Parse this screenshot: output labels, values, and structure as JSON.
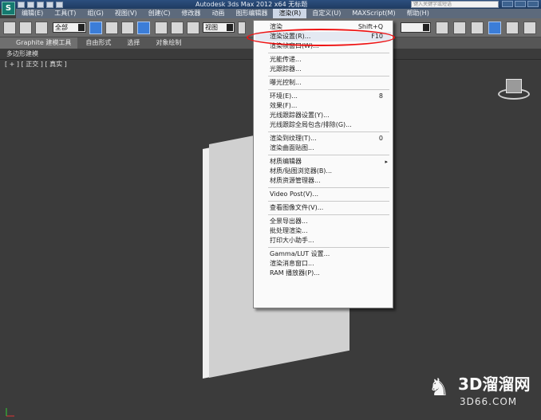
{
  "title_bar": {
    "title": "Autodesk 3ds Max  2012 x64      无标题",
    "search_placeholder": "键入关键字或短语"
  },
  "menubar": {
    "items": [
      {
        "label": "编辑(E)"
      },
      {
        "label": "工具(T)"
      },
      {
        "label": "组(G)"
      },
      {
        "label": "视图(V)"
      },
      {
        "label": "创建(C)"
      },
      {
        "label": "修改器"
      },
      {
        "label": "动画"
      },
      {
        "label": "图形编辑器"
      },
      {
        "label": "渲染(R)",
        "active": true
      },
      {
        "label": "自定义(U)"
      },
      {
        "label": "MAXScript(M)"
      },
      {
        "label": "帮助(H)"
      }
    ]
  },
  "toolbar": {
    "selection_filter": "全部",
    "reference_coord": "视图"
  },
  "ribbon": {
    "tabs": [
      "Graphite 建模工具",
      "自由形式",
      "选择",
      "对象绘制"
    ],
    "sub_label": "多边形建模"
  },
  "viewport": {
    "label": "[ + ] [ 正交 ] [ 真实 ]"
  },
  "render_menu": {
    "items": [
      {
        "label": "渲染",
        "shortcut": "Shift+Q"
      },
      {
        "label": "渲染设置(R)...",
        "shortcut": "F10",
        "highlighted": true
      },
      {
        "label": "渲染帧窗口(W)...",
        "shortcut": ""
      },
      {
        "separator": true
      },
      {
        "label": "光能传递...",
        "shortcut": ""
      },
      {
        "label": "光跟踪器...",
        "shortcut": ""
      },
      {
        "separator": true
      },
      {
        "label": "曝光控制...",
        "shortcut": ""
      },
      {
        "separator": true
      },
      {
        "label": "环境(E)...",
        "shortcut": "8"
      },
      {
        "label": "效果(F)...",
        "shortcut": ""
      },
      {
        "label": "光线跟踪器设置(Y)...",
        "shortcut": ""
      },
      {
        "label": "光线跟踪全局包含/排除(G)...",
        "shortcut": ""
      },
      {
        "separator": true
      },
      {
        "label": "渲染到纹理(T)...",
        "shortcut": "0"
      },
      {
        "label": "渲染曲面贴图...",
        "shortcut": ""
      },
      {
        "separator": true
      },
      {
        "label": "材质编辑器",
        "shortcut": "",
        "submenu": true
      },
      {
        "label": "材质/贴图浏览器(B)...",
        "shortcut": ""
      },
      {
        "label": "材质资源管理器...",
        "shortcut": ""
      },
      {
        "separator": true
      },
      {
        "label": "Video Post(V)...",
        "shortcut": ""
      },
      {
        "separator": true
      },
      {
        "label": "查看图像文件(V)...",
        "shortcut": ""
      },
      {
        "separator": true
      },
      {
        "label": "全景导出器...",
        "shortcut": ""
      },
      {
        "label": "批处理渲染...",
        "shortcut": ""
      },
      {
        "label": "打印大小助手...",
        "shortcut": ""
      },
      {
        "separator": true
      },
      {
        "label": "Gamma/LUT 设置...",
        "shortcut": ""
      },
      {
        "label": "渲染消息窗口...",
        "shortcut": ""
      },
      {
        "label": "RAM 播放器(P)...",
        "shortcut": ""
      }
    ]
  },
  "watermark": {
    "brand": "3D溜溜网",
    "url": "3D66.COM"
  },
  "colors": {
    "highlight_oval": "#e11111",
    "menubar_bg": "#5d6a7c",
    "viewport_bg": "#3b3b3b"
  }
}
